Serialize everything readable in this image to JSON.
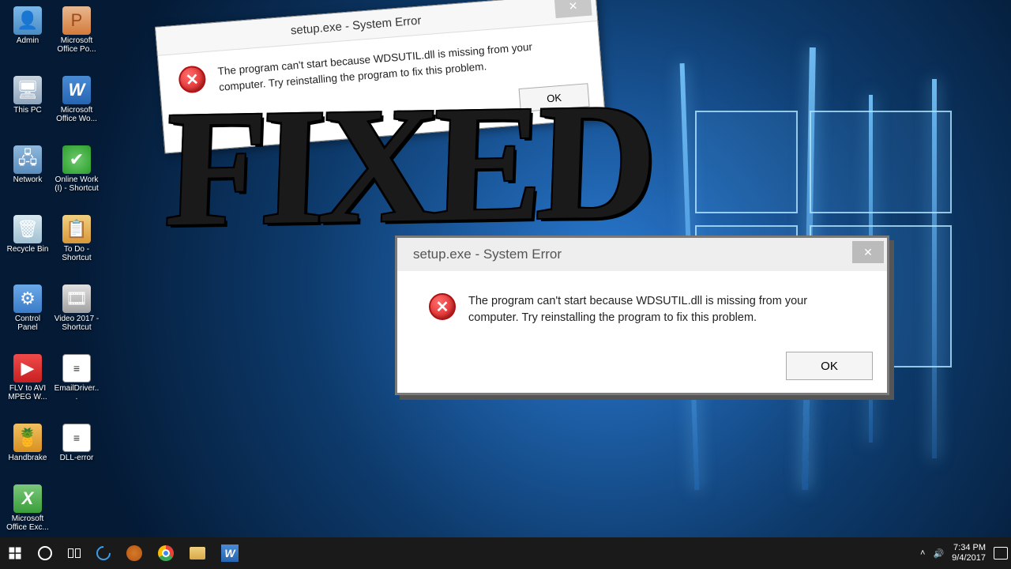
{
  "desktop_icons": [
    {
      "label": "Admin",
      "glyph": "g-admin",
      "sym": "👤"
    },
    {
      "label": "Microsoft Office Po...",
      "glyph": "g-ppt",
      "sym": "P"
    },
    {
      "label": "This PC",
      "glyph": "g-pc",
      "sym": "🖥"
    },
    {
      "label": "Microsoft Office Wo...",
      "glyph": "g-word",
      "sym": "W"
    },
    {
      "label": "Network",
      "glyph": "g-net",
      "sym": "🖧"
    },
    {
      "label": "Online Work (I) - Shortcut",
      "glyph": "g-check",
      "sym": "✔"
    },
    {
      "label": "Recycle Bin",
      "glyph": "g-bin",
      "sym": "🗑"
    },
    {
      "label": "To Do - Shortcut",
      "glyph": "g-todo",
      "sym": "📋"
    },
    {
      "label": "Control Panel",
      "glyph": "g-cp",
      "sym": "⚙"
    },
    {
      "label": "Video 2017 - Shortcut",
      "glyph": "g-vid",
      "sym": "🎞"
    },
    {
      "label": "FLV to AVI MPEG W...",
      "glyph": "g-flv",
      "sym": "▶"
    },
    {
      "label": "EmailDriver...",
      "glyph": "g-txt",
      "sym": "≡"
    },
    {
      "label": "Handbrake",
      "glyph": "g-hb",
      "sym": "🍍"
    },
    {
      "label": "DLL-error",
      "glyph": "g-txt",
      "sym": "≡"
    },
    {
      "label": "Microsoft Office Exc...",
      "glyph": "g-xl",
      "sym": "X"
    }
  ],
  "dialog1": {
    "title": "setup.exe - System Error",
    "message": "The program can't start because WDSUTIL.dll is missing from your computer. Try reinstalling the program to fix this problem.",
    "ok": "OK",
    "close": "✕"
  },
  "dialog2": {
    "title": "setup.exe - System Error",
    "message": "The program can't start because WDSUTIL.dll is missing from your computer. Try reinstalling the program to fix this problem.",
    "ok": "OK",
    "close": "✕"
  },
  "overlay": "FIXED",
  "taskbar": {
    "tray": {
      "chevron": "˄",
      "vol": "🔊",
      "time": "7:34 PM",
      "date": "9/4/2017"
    }
  }
}
